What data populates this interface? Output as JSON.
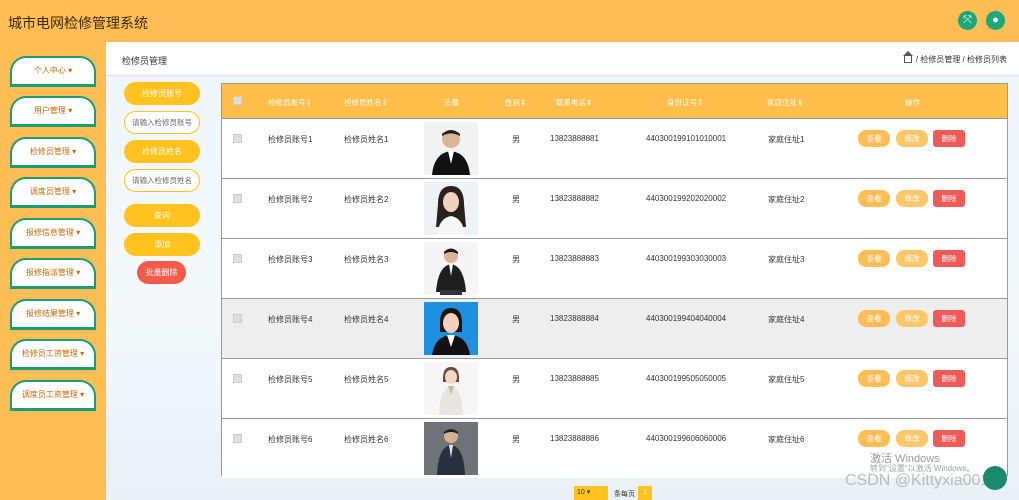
{
  "app": {
    "title": "城市电网检修管理系统"
  },
  "header": {
    "icons": [
      "expand-icon",
      "user-icon"
    ]
  },
  "sidebar": {
    "items": [
      {
        "label": "个人中心"
      },
      {
        "label": "用户管理"
      },
      {
        "label": "检修员管理"
      },
      {
        "label": "调度员管理"
      },
      {
        "label": "报修信息管理"
      },
      {
        "label": "报修指派管理"
      },
      {
        "label": "报修结果管理"
      },
      {
        "label": "检修员工资管理"
      },
      {
        "label": "调度员工资管理"
      }
    ]
  },
  "page": {
    "title": "检修员管理",
    "breadcrumb": "/ 检修员管理 / 检修员列表"
  },
  "filters": {
    "account_label": "检修员账号",
    "account_placeholder": "请输入检修员账号",
    "name_label": "检修员姓名",
    "name_placeholder": "请输入检修员姓名",
    "search_label": "查询",
    "add_label": "添加",
    "batch_delete_label": "批量删除"
  },
  "table": {
    "headers": [
      "检修员账号",
      "检修员姓名",
      "头像",
      "性别",
      "联系电话",
      "身份证号",
      "家庭住址",
      "操作"
    ],
    "rows": [
      {
        "account": "检修员账号1",
        "name": "检修员姓名1",
        "gender": "男",
        "phone": "13823888881",
        "id_card": "440300199101010001",
        "address": "家庭住址1"
      },
      {
        "account": "检修员账号2",
        "name": "检修员姓名2",
        "gender": "男",
        "phone": "13823888882",
        "id_card": "440300199202020002",
        "address": "家庭住址2"
      },
      {
        "account": "检修员账号3",
        "name": "检修员姓名3",
        "gender": "男",
        "phone": "13823888883",
        "id_card": "440300199303030003",
        "address": "家庭住址3"
      },
      {
        "account": "检修员账号4",
        "name": "检修员姓名4",
        "gender": "男",
        "phone": "13823888884",
        "id_card": "440300199404040004",
        "address": "家庭住址4"
      },
      {
        "account": "检修员账号5",
        "name": "检修员姓名5",
        "gender": "男",
        "phone": "13823888885",
        "id_card": "440300199505050005",
        "address": "家庭住址5"
      },
      {
        "account": "检修员账号6",
        "name": "检修员姓名6",
        "gender": "男",
        "phone": "13823888886",
        "id_card": "440300199606060006",
        "address": "家庭住址6"
      }
    ],
    "actions": {
      "view": "查看",
      "edit": "修改",
      "delete": "删除"
    }
  },
  "pager": {
    "page_size": "10",
    "page_size_label": "条每页",
    "current_page": "1"
  },
  "watermarks": {
    "line1": "激活 Windows",
    "line2": "转到\"设置\"以激活 Windows。",
    "line3": "CSDN @Kittyxia001"
  },
  "colors": {
    "accent": "#ffbd55",
    "nav_border": "#1b9d78",
    "delete": "#f25a5a"
  }
}
